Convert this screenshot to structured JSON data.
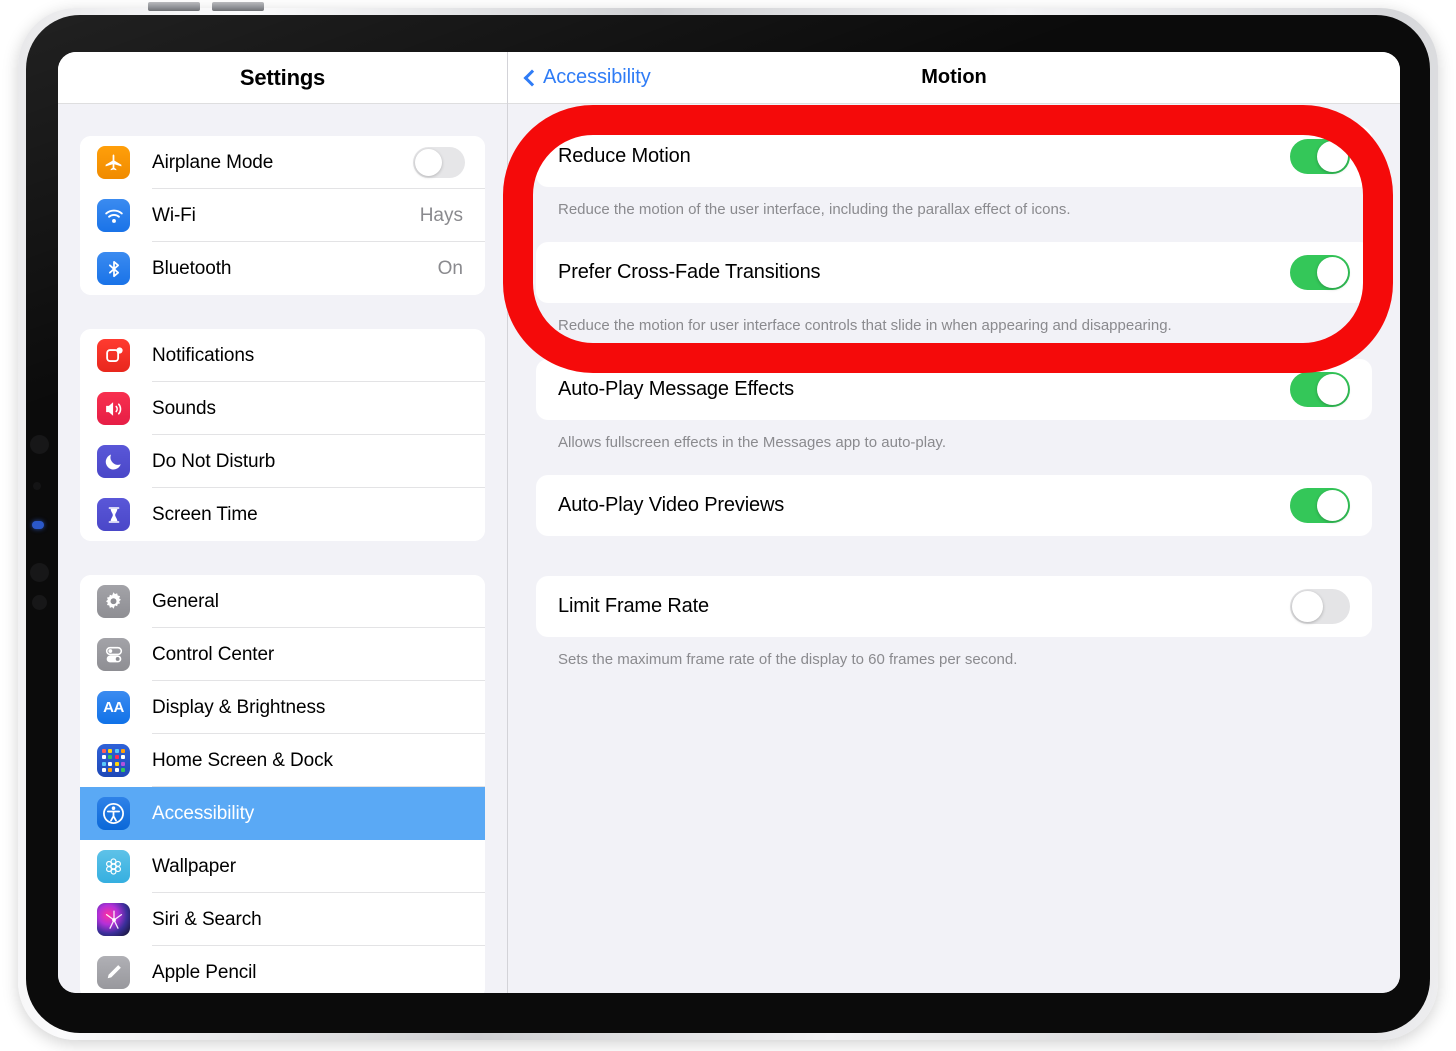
{
  "device": {
    "name": "ipad-frame"
  },
  "sidebar": {
    "title": "Settings",
    "groups": [
      {
        "items": [
          {
            "label": "Airplane Mode",
            "icon": "airplane-icon",
            "control": "toggle",
            "toggle": "off"
          },
          {
            "label": "Wi-Fi",
            "icon": "wifi-icon",
            "value": "Hays"
          },
          {
            "label": "Bluetooth",
            "icon": "bluetooth-icon",
            "value": "On"
          }
        ]
      },
      {
        "items": [
          {
            "label": "Notifications",
            "icon": "notifications-icon"
          },
          {
            "label": "Sounds",
            "icon": "sounds-icon"
          },
          {
            "label": "Do Not Disturb",
            "icon": "moon-icon"
          },
          {
            "label": "Screen Time",
            "icon": "hourglass-icon"
          }
        ]
      },
      {
        "items": [
          {
            "label": "General",
            "icon": "gear-icon"
          },
          {
            "label": "Control Center",
            "icon": "control-center-icon"
          },
          {
            "label": "Display & Brightness",
            "icon": "display-brightness-icon"
          },
          {
            "label": "Home Screen & Dock",
            "icon": "home-screen-icon"
          },
          {
            "label": "Accessibility",
            "icon": "accessibility-icon",
            "selected": true
          },
          {
            "label": "Wallpaper",
            "icon": "wallpaper-icon"
          },
          {
            "label": "Siri & Search",
            "icon": "siri-icon"
          },
          {
            "label": "Apple Pencil",
            "icon": "apple-pencil-icon"
          }
        ]
      }
    ]
  },
  "detail": {
    "back_label": "Accessibility",
    "title": "Motion",
    "sections": [
      {
        "rows": [
          {
            "label": "Reduce Motion",
            "toggle": "on"
          }
        ],
        "footnote": "Reduce the motion of the user interface, including the parallax effect of icons."
      },
      {
        "rows": [
          {
            "label": "Prefer Cross-Fade Transitions",
            "toggle": "on"
          }
        ],
        "footnote": "Reduce the motion for user interface controls that slide in when appearing and disappearing."
      },
      {
        "rows": [
          {
            "label": "Auto-Play Message Effects",
            "toggle": "on"
          }
        ],
        "footnote": "Allows fullscreen effects in the Messages app to auto-play."
      },
      {
        "rows": [
          {
            "label": "Auto-Play Video Previews",
            "toggle": "on"
          }
        ],
        "footnote": ""
      },
      {
        "rows": [
          {
            "label": "Limit Frame Rate",
            "toggle": "off"
          }
        ],
        "footnote": "Sets the maximum frame rate of the display to 60 frames per second."
      }
    ]
  },
  "annotation": {
    "shape": "rounded-rectangle-highlight",
    "color": "#f50a0a"
  },
  "colors": {
    "accent_blue": "#2f7cf6",
    "selected_row_blue": "#5aa9f5",
    "toggle_on_green": "#34c759",
    "toggle_off_gray": "#e4e4e6",
    "pane_background": "#f2f2f7",
    "annotation_red": "#f50a0a"
  }
}
